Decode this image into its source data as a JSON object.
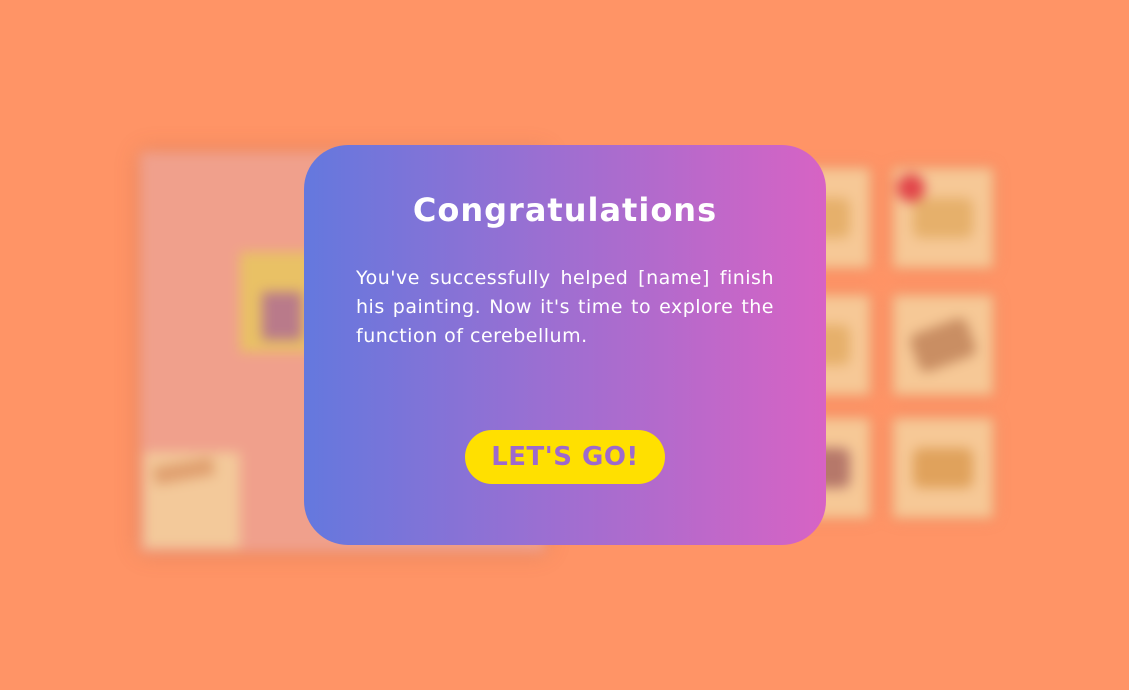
{
  "dialog": {
    "title": "Congratulations",
    "message": "You've successfully helped [name] finish his painting. Now it's time to explore the function of cerebellum.",
    "button_label": "LET'S GO!"
  },
  "colors": {
    "background": "#ff9466",
    "dialog_gradient_start": "#6478de",
    "dialog_gradient_end": "#d763c4",
    "button_bg": "#ffe000",
    "button_text": "#9d69cd"
  }
}
